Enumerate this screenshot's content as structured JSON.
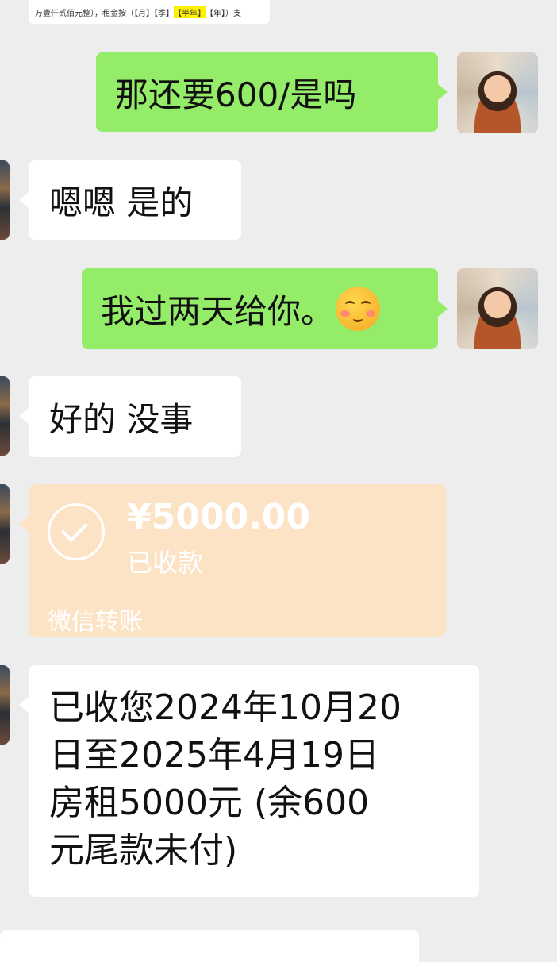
{
  "doc_snippet": {
    "text_underlined": "万壹仟贰佰元整",
    "text_mid": "），租金按（【月】【季】",
    "text_highlight": "【半年】",
    "text_end": "【年】）支"
  },
  "messages": [
    {
      "side": "right",
      "text": "那还要600/是吗"
    },
    {
      "side": "left",
      "text": "嗯嗯 是的"
    },
    {
      "side": "right",
      "text": "我过两天给你。",
      "emoji": "shy-smile-emoji"
    },
    {
      "side": "left",
      "text": "好的 没事"
    }
  ],
  "transfer": {
    "amount": "¥5000.00",
    "status": "已收款",
    "label": "微信转账"
  },
  "long_message": {
    "line1": "已收您2024年10月20",
    "line2": "日至2025年4月19日",
    "line3": "房租5000元 (余600",
    "line4": "元尾款未付)"
  },
  "colors": {
    "background": "#ededed",
    "green_bubble": "#95ec69",
    "transfer_card": "#fde3c6"
  }
}
